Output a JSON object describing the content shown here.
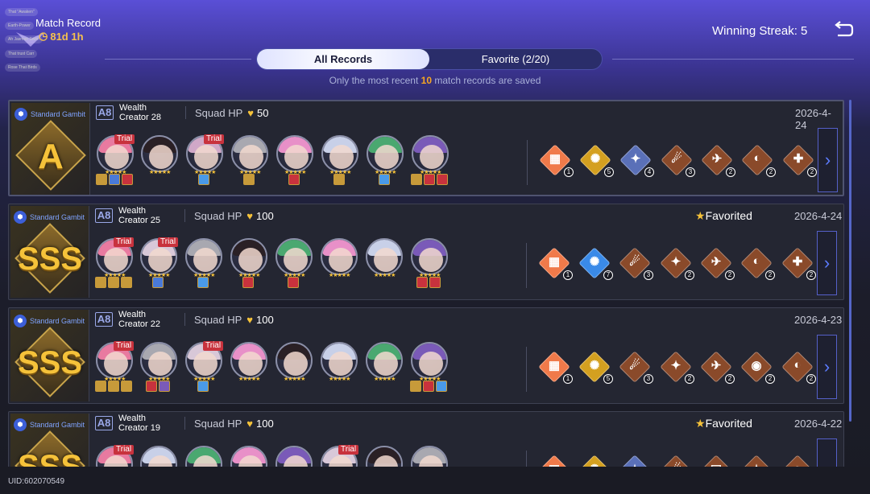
{
  "header": {
    "title": "Match Record",
    "timer": "81d 1h",
    "streak": "Winning Streak: 5",
    "mini_tags": [
      "That \"Awaken\"",
      "Earth-Power",
      "Ah Jasmon Swim",
      "That trust Carr",
      "Rose That Birds"
    ]
  },
  "tabs": [
    {
      "label": "All Records",
      "active": true
    },
    {
      "label": "Favorite (2/20)",
      "active": false
    }
  ],
  "note": {
    "pre": "Only the most recent ",
    "count": "10",
    "post": " match records are saved"
  },
  "records": [
    {
      "mode": "Standard Gambit",
      "grade": "A",
      "difficulty": "A8",
      "wealth1": "Wealth",
      "wealth2": "Creator 28",
      "hp_label": "Squad HP",
      "hp": "50",
      "favorited": "",
      "date": "2026-4-24",
      "chars": [
        {
          "c": "#e87aa0",
          "t": true,
          "r": [
            "#c79a3a",
            "#4a7ad8",
            "#c8323d"
          ]
        },
        {
          "c": "#2a2025",
          "r": []
        },
        {
          "c": "#d0a8c8",
          "t": true,
          "r": [
            "#4a9ae8"
          ]
        },
        {
          "c": "#a8a8b0",
          "r": [
            "#c79a3a"
          ]
        },
        {
          "c": "#e890c8",
          "r": [
            "#c8323d"
          ]
        },
        {
          "c": "#c8d0e8",
          "r": [
            "#c79a3a"
          ]
        },
        {
          "c": "#4aa870",
          "r": [
            "#4a9ae8"
          ]
        },
        {
          "c": "#7a5ab8",
          "r": [
            "#c79a3a",
            "#c8323d",
            "#c8323d"
          ]
        }
      ],
      "blessings": [
        {
          "g": "▦",
          "c": "#f07a4a",
          "n": "1"
        },
        {
          "g": "✺",
          "c": "#d4a020",
          "n": "5"
        },
        {
          "g": "✦",
          "c": "#5a70b8",
          "n": "4"
        },
        {
          "g": "☄",
          "c": "#8a4a2a",
          "n": "3"
        },
        {
          "g": "✈",
          "c": "#8a4a2a",
          "n": "2"
        },
        {
          "g": "◐",
          "c": "#8a4a2a",
          "n": "2"
        },
        {
          "g": "✚",
          "c": "#8a4a2a",
          "n": "2"
        }
      ]
    },
    {
      "mode": "Standard Gambit",
      "grade": "SSS",
      "difficulty": "A8",
      "wealth1": "Wealth",
      "wealth2": "Creator 25",
      "hp_label": "Squad HP",
      "hp": "100",
      "favorited": "Favorited",
      "date": "2026-4-24",
      "chars": [
        {
          "c": "#e87aa0",
          "t": true,
          "r": [
            "#c79a3a",
            "#c79a3a",
            "#c79a3a"
          ]
        },
        {
          "c": "#d8c8d8",
          "t": true,
          "r": [
            "#4a7ad8"
          ]
        },
        {
          "c": "#a8a8b0",
          "r": [
            "#4a9ae8"
          ]
        },
        {
          "c": "#2a2025",
          "r": [
            "#c8323d"
          ]
        },
        {
          "c": "#4aa870",
          "r": [
            "#c8323d"
          ]
        },
        {
          "c": "#e890c8",
          "r": []
        },
        {
          "c": "#c8d0e8",
          "r": []
        },
        {
          "c": "#7a5ab8",
          "r": [
            "#c8323d",
            "#c8323d"
          ]
        }
      ],
      "blessings": [
        {
          "g": "▦",
          "c": "#f07a4a",
          "n": "1"
        },
        {
          "g": "✺",
          "c": "#3a8ae8",
          "n": "7"
        },
        {
          "g": "☄",
          "c": "#8a4a2a",
          "n": "3"
        },
        {
          "g": "✦",
          "c": "#8a4a2a",
          "n": "2"
        },
        {
          "g": "✈",
          "c": "#8a4a2a",
          "n": "2"
        },
        {
          "g": "◐",
          "c": "#8a4a2a",
          "n": "2"
        },
        {
          "g": "✚",
          "c": "#8a4a2a",
          "n": "2"
        }
      ]
    },
    {
      "mode": "Standard Gambit",
      "grade": "SSS",
      "difficulty": "A8",
      "wealth1": "Wealth",
      "wealth2": "Creator 22",
      "hp_label": "Squad HP",
      "hp": "100",
      "favorited": "",
      "date": "2026-4-23",
      "chars": [
        {
          "c": "#e87aa0",
          "t": true,
          "r": [
            "#c79a3a",
            "#c79a3a",
            "#c79a3a"
          ]
        },
        {
          "c": "#a8a8b0",
          "r": [
            "#c8323d",
            "#7a5ab8"
          ]
        },
        {
          "c": "#d8c8d8",
          "t": true,
          "r": [
            "#4a9ae8"
          ]
        },
        {
          "c": "#e890c8",
          "r": []
        },
        {
          "c": "#2a2025",
          "r": []
        },
        {
          "c": "#c8d0e8",
          "r": []
        },
        {
          "c": "#4aa870",
          "r": []
        },
        {
          "c": "#7a5ab8",
          "r": [
            "#c79a3a",
            "#c8323d",
            "#4a9ae8"
          ]
        }
      ],
      "blessings": [
        {
          "g": "▦",
          "c": "#f07a4a",
          "n": "1"
        },
        {
          "g": "✺",
          "c": "#d4a020",
          "n": "5"
        },
        {
          "g": "☄",
          "c": "#8a4a2a",
          "n": "3"
        },
        {
          "g": "✦",
          "c": "#8a4a2a",
          "n": "2"
        },
        {
          "g": "✈",
          "c": "#8a4a2a",
          "n": "2"
        },
        {
          "g": "◉",
          "c": "#8a4a2a",
          "n": "2"
        },
        {
          "g": "◐",
          "c": "#8a4a2a",
          "n": "2"
        }
      ]
    },
    {
      "mode": "Standard Gambit",
      "grade": "SSS",
      "difficulty": "A8",
      "wealth1": "Wealth",
      "wealth2": "Creator 19",
      "hp_label": "Squad HP",
      "hp": "100",
      "favorited": "Favorited",
      "date": "2026-4-22",
      "chars": [
        {
          "c": "#e87aa0",
          "t": true,
          "r": []
        },
        {
          "c": "#c8d0e8",
          "r": []
        },
        {
          "c": "#4aa870",
          "r": []
        },
        {
          "c": "#e890c8",
          "r": []
        },
        {
          "c": "#7a5ab8",
          "r": []
        },
        {
          "c": "#d8c8d8",
          "t": true,
          "r": []
        },
        {
          "c": "#2a2025",
          "r": []
        },
        {
          "c": "#a8a8b0",
          "r": []
        }
      ],
      "blessings": [
        {
          "g": "▦",
          "c": "#f07a4a",
          "n": ""
        },
        {
          "g": "✺",
          "c": "#d4a020",
          "n": ""
        },
        {
          "g": "✦",
          "c": "#5a70b8",
          "n": ""
        },
        {
          "g": "☄",
          "c": "#8a4a2a",
          "n": ""
        },
        {
          "g": "▣",
          "c": "#8a4a2a",
          "n": ""
        },
        {
          "g": "✦",
          "c": "#8a4a2a",
          "n": ""
        },
        {
          "g": "◐",
          "c": "#8a4a2a",
          "n": ""
        }
      ]
    }
  ],
  "trial_label": "Trial",
  "uid": "UID:602070549"
}
